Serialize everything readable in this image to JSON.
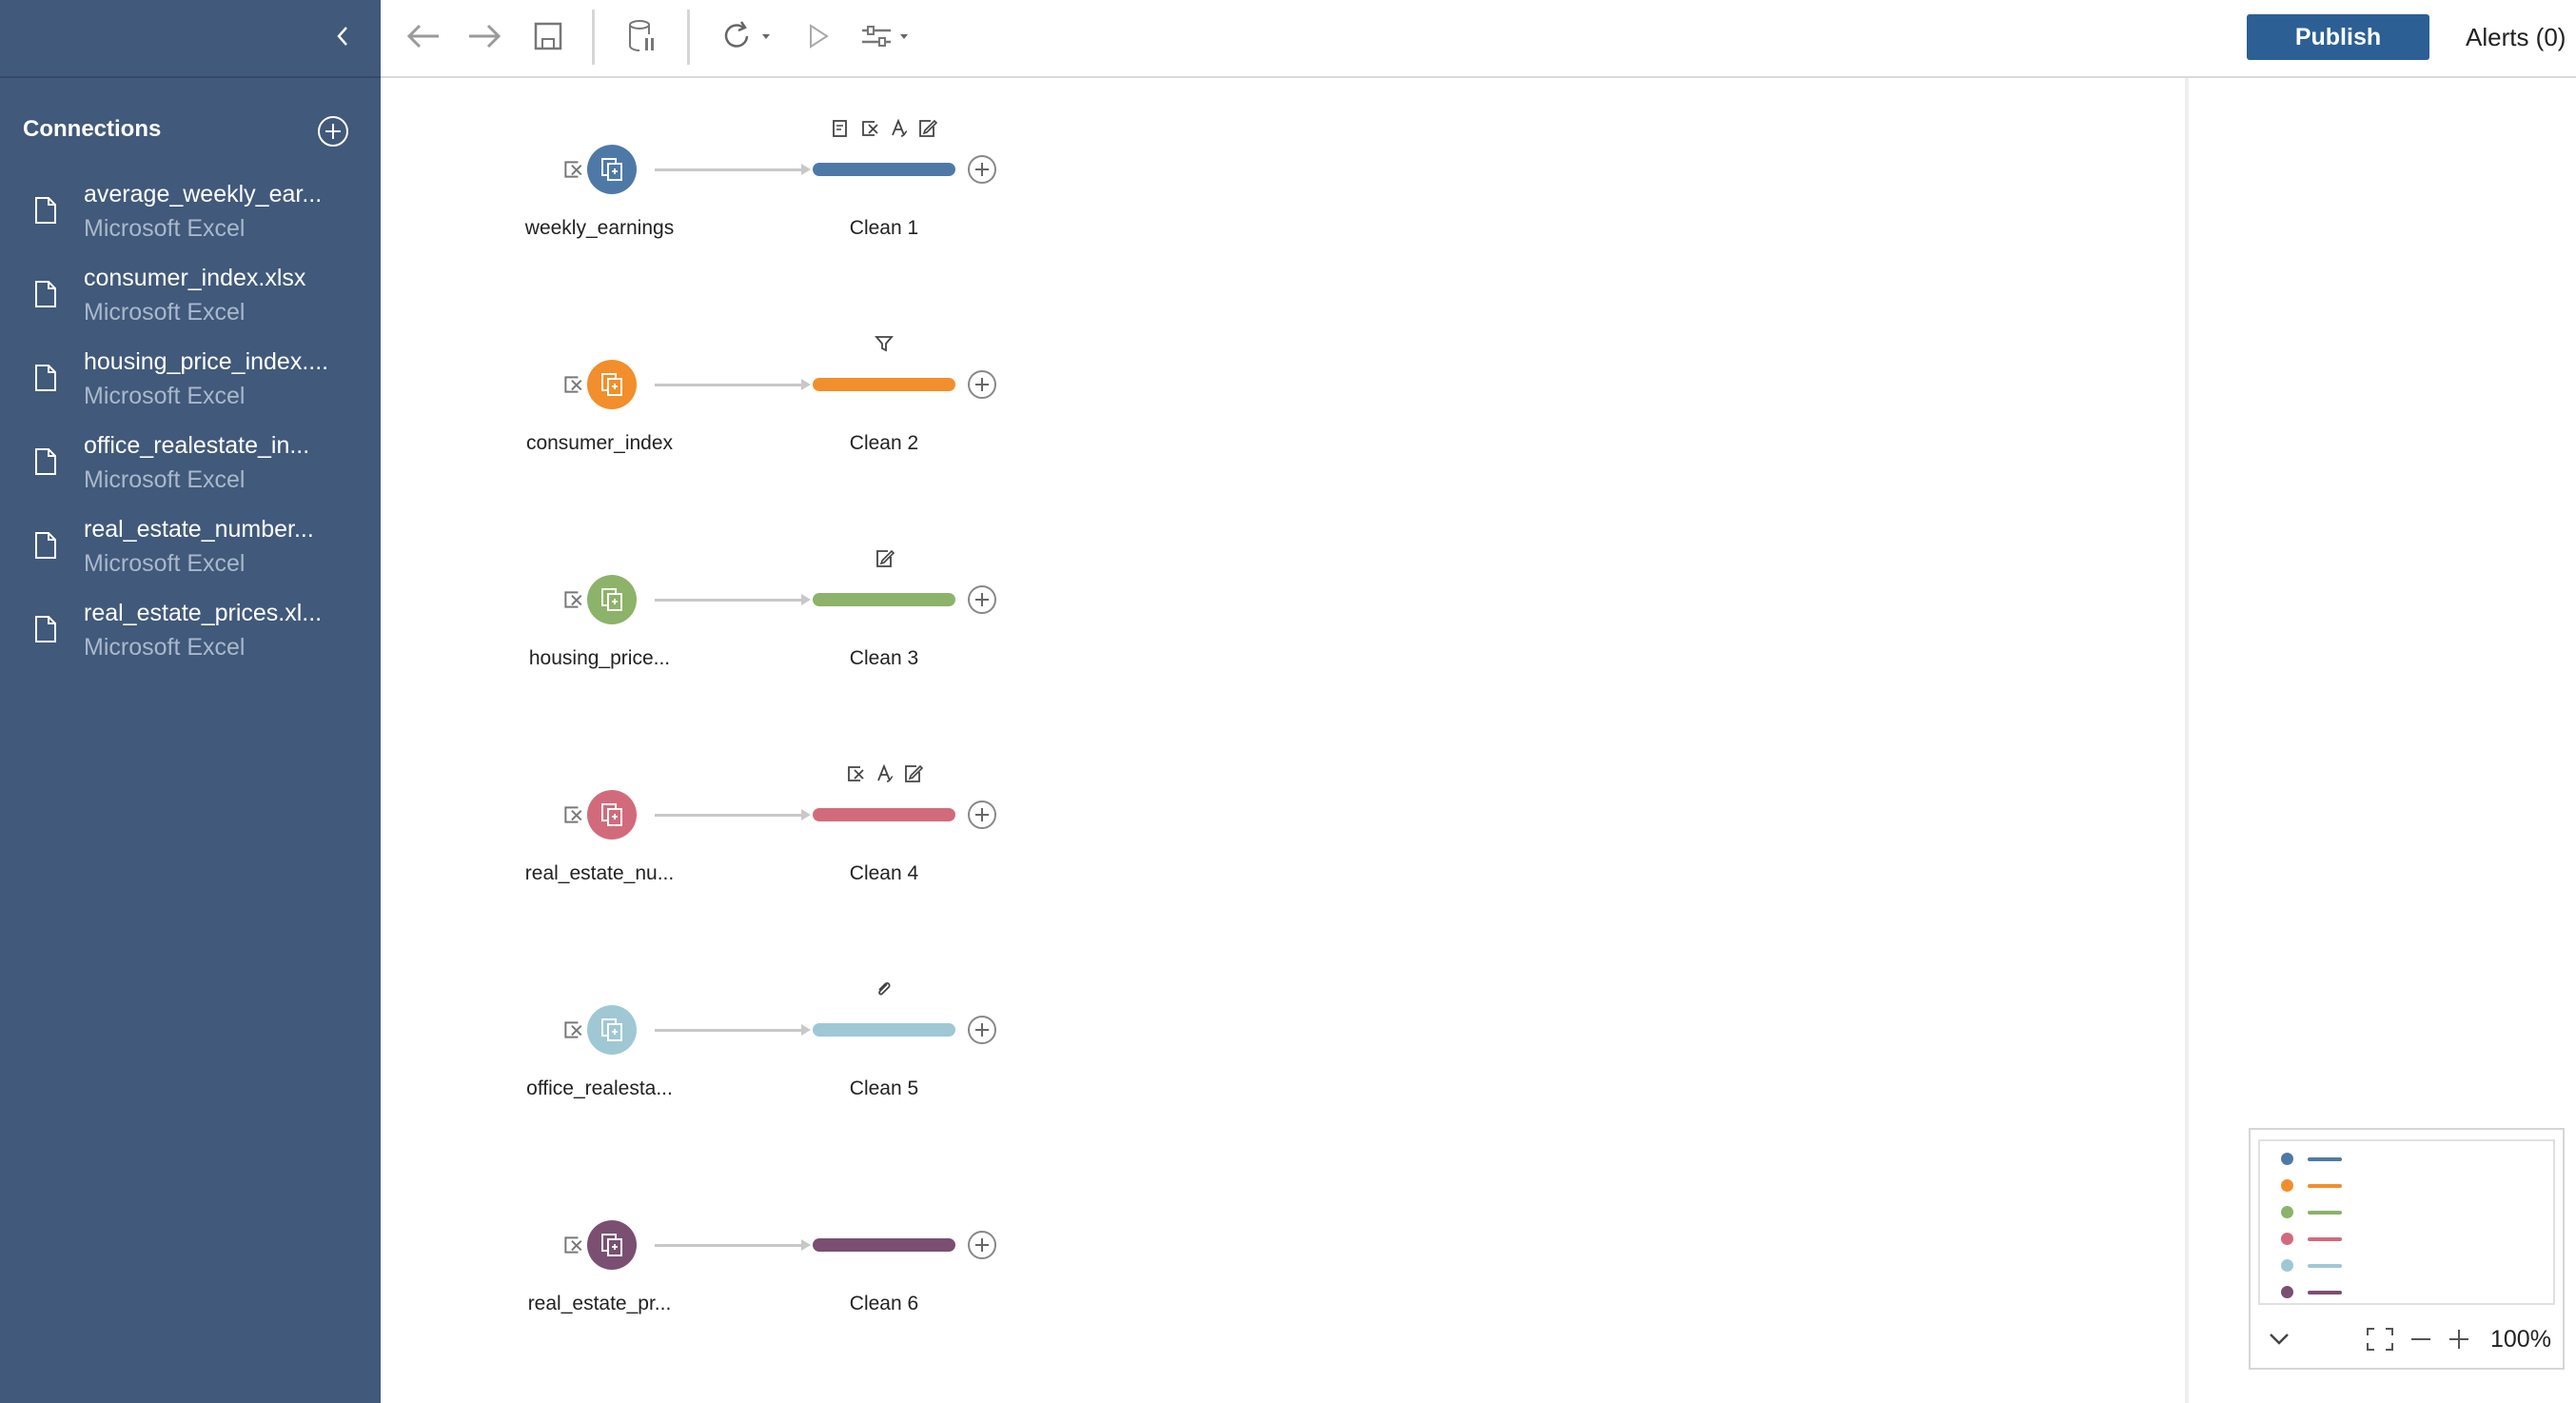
{
  "sidebar": {
    "connections_title": "Connections",
    "connections": [
      {
        "name": "average_weekly_ear...",
        "type": "Microsoft Excel"
      },
      {
        "name": "consumer_index.xlsx",
        "type": "Microsoft Excel"
      },
      {
        "name": "housing_price_index....",
        "type": "Microsoft Excel"
      },
      {
        "name": "office_realestate_in...",
        "type": "Microsoft Excel"
      },
      {
        "name": "real_estate_number...",
        "type": "Microsoft Excel"
      },
      {
        "name": "real_estate_prices.xl...",
        "type": "Microsoft Excel"
      }
    ]
  },
  "toolbar": {
    "publish_label": "Publish",
    "alerts_label": "Alerts (0)",
    "icons": [
      "back-arrow-icon",
      "forward-arrow-icon",
      "save-icon",
      "data-sampling-icon",
      "refresh-icon",
      "run-icon",
      "settings-icon"
    ]
  },
  "flows": [
    {
      "input_label": "weekly_earnings",
      "clean_label": "Clean 1",
      "color": "#4e79a7",
      "step_icons": [
        "rename-icon",
        "remove-field-icon",
        "split-icon",
        "edit-value-icon"
      ]
    },
    {
      "input_label": "consumer_index",
      "clean_label": "Clean 2",
      "color": "#f28e2b",
      "step_icons": [
        "filter-icon"
      ]
    },
    {
      "input_label": "housing_price...",
      "clean_label": "Clean 3",
      "color": "#8cb369",
      "step_icons": [
        "edit-value-icon"
      ]
    },
    {
      "input_label": "real_estate_nu...",
      "clean_label": "Clean 4",
      "color": "#d16b7c",
      "step_icons": [
        "remove-field-icon",
        "split-icon",
        "edit-value-icon"
      ]
    },
    {
      "input_label": "office_realesta...",
      "clean_label": "Clean 5",
      "color": "#9fc8d4",
      "step_icons": [
        "group-values-icon"
      ]
    },
    {
      "input_label": "real_estate_pr...",
      "clean_label": "Clean 6",
      "color": "#7a4f72",
      "step_icons": []
    }
  ],
  "overview": {
    "zoom_level": "100%"
  }
}
